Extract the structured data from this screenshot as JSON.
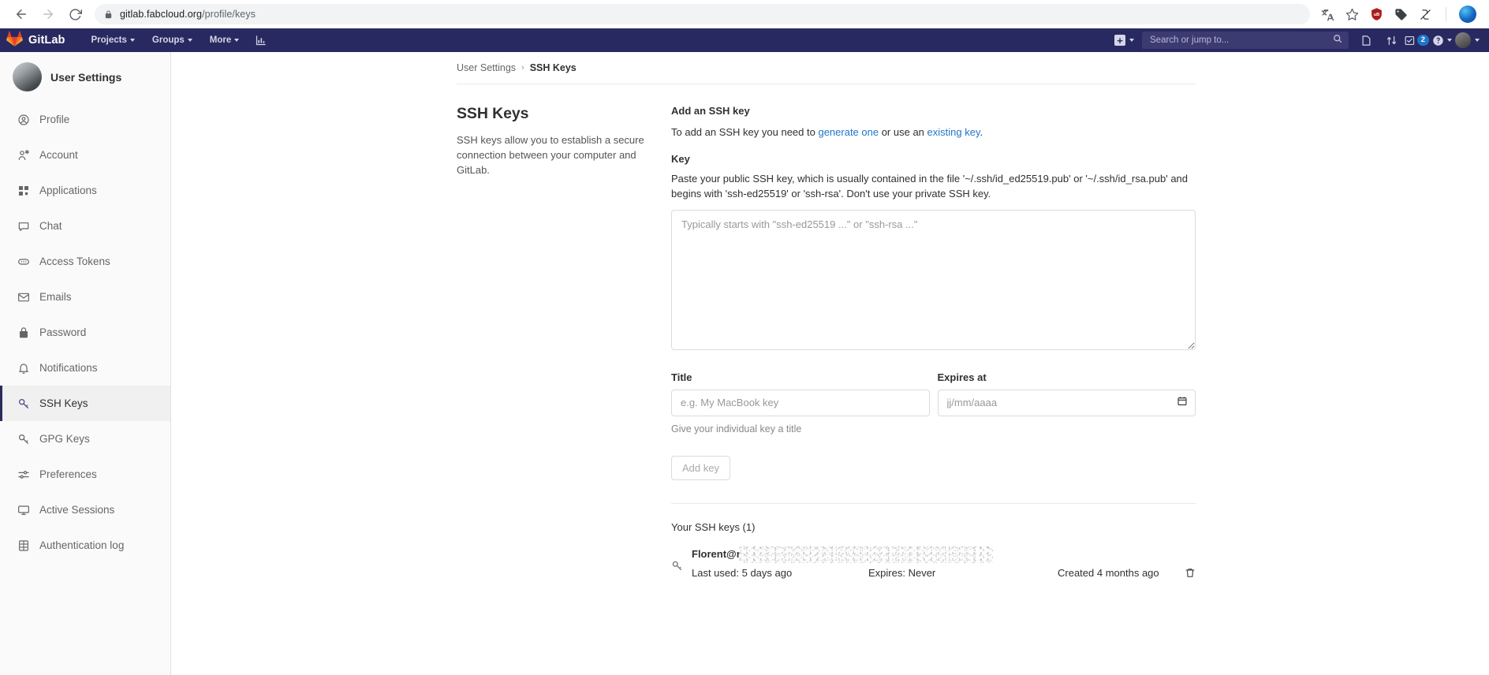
{
  "browser": {
    "back_icon": "back-arrow-icon",
    "forward_icon": "forward-arrow-icon",
    "reload_icon": "reload-icon",
    "lock_icon": "lock-icon",
    "url_host": "gitlab.fabcloud.org",
    "url_path": "/profile/keys",
    "extensions": [
      "translate-icon",
      "bookmark-star-icon",
      "ublock-origin-icon",
      "tag-icon",
      "extension-icon"
    ]
  },
  "navbar": {
    "brand": "GitLab",
    "items": [
      {
        "label": "Projects",
        "caret": true
      },
      {
        "label": "Groups",
        "caret": true
      },
      {
        "label": "More",
        "caret": true
      }
    ],
    "analytics_icon": "chart-bar-icon",
    "create_new_label": "+",
    "search": {
      "placeholder": "Search or jump to...",
      "value": ""
    },
    "issues_icon": "issues-icon",
    "merge_requests_icon": "merge-request-icon",
    "todos_icon": "todos-icon",
    "todos_count": "2",
    "help_icon": "help-circle-icon",
    "avatar": "user-avatar"
  },
  "sidebar": {
    "header": "User Settings",
    "items": [
      {
        "label": "Profile",
        "icon": "profile-icon",
        "active": false
      },
      {
        "label": "Account",
        "icon": "account-icon",
        "active": false
      },
      {
        "label": "Applications",
        "icon": "applications-icon",
        "active": false
      },
      {
        "label": "Chat",
        "icon": "chat-icon",
        "active": false
      },
      {
        "label": "Access Tokens",
        "icon": "token-icon",
        "active": false
      },
      {
        "label": "Emails",
        "icon": "envelope-icon",
        "active": false
      },
      {
        "label": "Password",
        "icon": "lock-icon",
        "active": false
      },
      {
        "label": "Notifications",
        "icon": "bell-icon",
        "active": false
      },
      {
        "label": "SSH Keys",
        "icon": "key-icon",
        "active": true
      },
      {
        "label": "GPG Keys",
        "icon": "key-icon",
        "active": false
      },
      {
        "label": "Preferences",
        "icon": "sliders-icon",
        "active": false
      },
      {
        "label": "Active Sessions",
        "icon": "monitor-icon",
        "active": false
      },
      {
        "label": "Authentication log",
        "icon": "log-icon",
        "active": false
      }
    ]
  },
  "breadcrumb": {
    "parent": "User Settings",
    "separator": "›",
    "current": "SSH Keys"
  },
  "page": {
    "heading": "SSH Keys",
    "description": "SSH keys allow you to establish a secure connection between your computer and GitLab."
  },
  "form": {
    "title": "Add an SSH key",
    "desc_part1": "To add an SSH key you need to ",
    "link_generate": "generate one",
    "desc_part2": " or use an ",
    "link_existing": "existing key",
    "desc_part3": ".",
    "key_label": "Key",
    "key_hint": "Paste your public SSH key, which is usually contained in the file '~/.ssh/id_ed25519.pub' or '~/.ssh/id_rsa.pub' and begins with 'ssh-ed25519' or 'ssh-rsa'. Don't use your private SSH key.",
    "key_placeholder": "Typically starts with \"ssh-ed25519 ...\" or \"ssh-rsa ...\"",
    "key_value": "",
    "title_label": "Title",
    "title_placeholder": "e.g. My MacBook key",
    "title_value": "",
    "title_hint": "Give your individual key a title",
    "expires_label": "Expires at",
    "expires_placeholder": "jj/mm/aaaa",
    "expires_value": "",
    "calendar_icon": "calendar-icon",
    "submit_label": "Add key"
  },
  "keys_list": {
    "title": "Your SSH keys (1)",
    "rows": [
      {
        "icon": "key-icon",
        "name": "Florent@r",
        "redacted": true,
        "last_used": "Last used: 5 days ago",
        "expires": "Expires: Never",
        "created": "Created 4 months ago",
        "delete_icon": "trash-icon"
      }
    ]
  },
  "colors": {
    "navbar_bg": "#292961",
    "sidebar_bg": "#fafafa",
    "link": "#1f75cb",
    "badge": "#1f75cb",
    "active_border": "#2b2b5f"
  }
}
